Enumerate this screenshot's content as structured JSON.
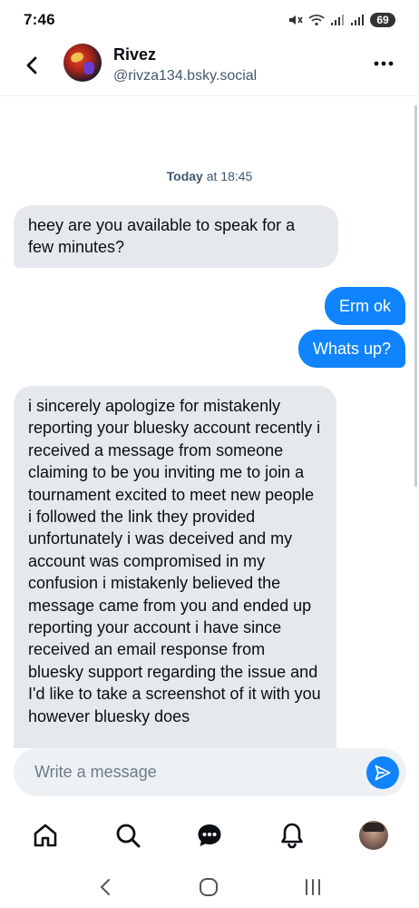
{
  "status_bar": {
    "time": "7:46",
    "battery": "69",
    "icons": [
      "mute-icon",
      "wifi-icon",
      "signal-icon",
      "signal-icon",
      "battery-icon"
    ]
  },
  "header": {
    "name": "Rivez",
    "handle": "@rivza134.bsky.social",
    "back_icon": "chevron-left-icon",
    "more_icon": "ellipsis-icon"
  },
  "chat": {
    "date_bold": "Today",
    "date_rest": " at 18:45",
    "messages": [
      {
        "from": "them",
        "text": "heey are you available to speak for a few minutes?"
      },
      {
        "from": "me",
        "text": "Erm ok"
      },
      {
        "from": "me",
        "text": "Whats up?"
      },
      {
        "from": "them",
        "text": "i sincerely apologize for mistakenly reporting your bluesky account recently i received a message from someone claiming to be you inviting me to join a tournament excited to meet new people i followed the link they provided unfortunately i was deceived and my account was compromised in my confusion i mistakenly believed the message came from you and ended up reporting your account i have since received an email response from bluesky support regarding the issue and I'd like to take a screenshot of it with you however bluesky does"
      }
    ]
  },
  "composer": {
    "placeholder": "Write a message",
    "send_icon": "send-icon"
  },
  "tabs": [
    {
      "name": "home",
      "icon": "home-icon"
    },
    {
      "name": "search",
      "icon": "search-icon"
    },
    {
      "name": "chat",
      "icon": "chat-icon"
    },
    {
      "name": "notifications",
      "icon": "bell-icon"
    },
    {
      "name": "profile",
      "icon": "avatar"
    }
  ],
  "colors": {
    "accent": "#1083fe",
    "incoming_bubble": "#e5e9ed",
    "muted_text": "#42576c"
  }
}
